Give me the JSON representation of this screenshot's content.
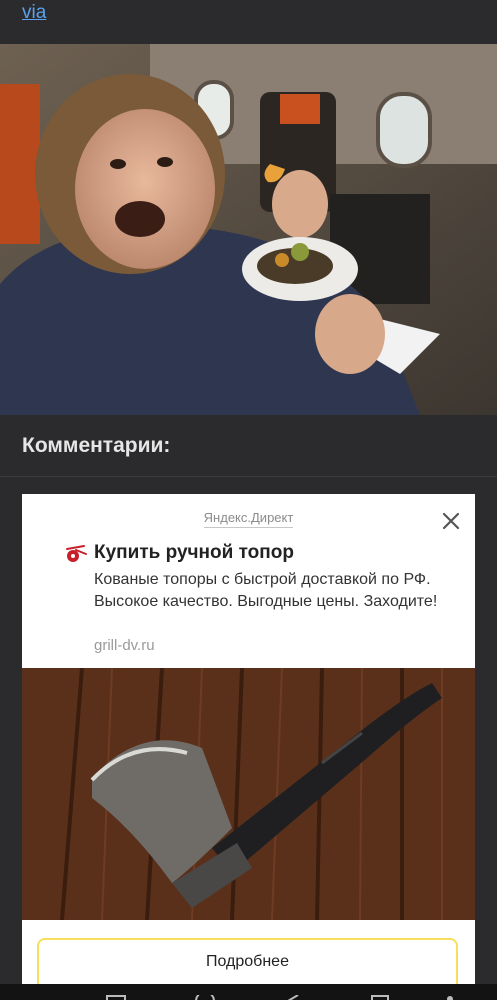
{
  "header": {
    "link_text": "via"
  },
  "photo": {
    "icon": "airplane-passenger-photo"
  },
  "comments": {
    "heading": "Комментарии:"
  },
  "ad": {
    "source_label": "Яндекс.Директ",
    "title": "Купить ручной топор",
    "description": "Кованые топоры с быстрой доставкой по РФ. Высокое качество. Выгодные цены. Заходите!",
    "domain": "grill-dv.ru",
    "image_icon": "axe-on-wood-image",
    "button_label": "Подробнее"
  },
  "colors": {
    "accent_button_border": "#f7de5c",
    "link": "#5aa2f0",
    "background": "#2b2b2d"
  },
  "nav_bar": {
    "icons": [
      "menu-icon",
      "home-icon",
      "back-icon",
      "accessibility-icon",
      "person-icon"
    ]
  }
}
